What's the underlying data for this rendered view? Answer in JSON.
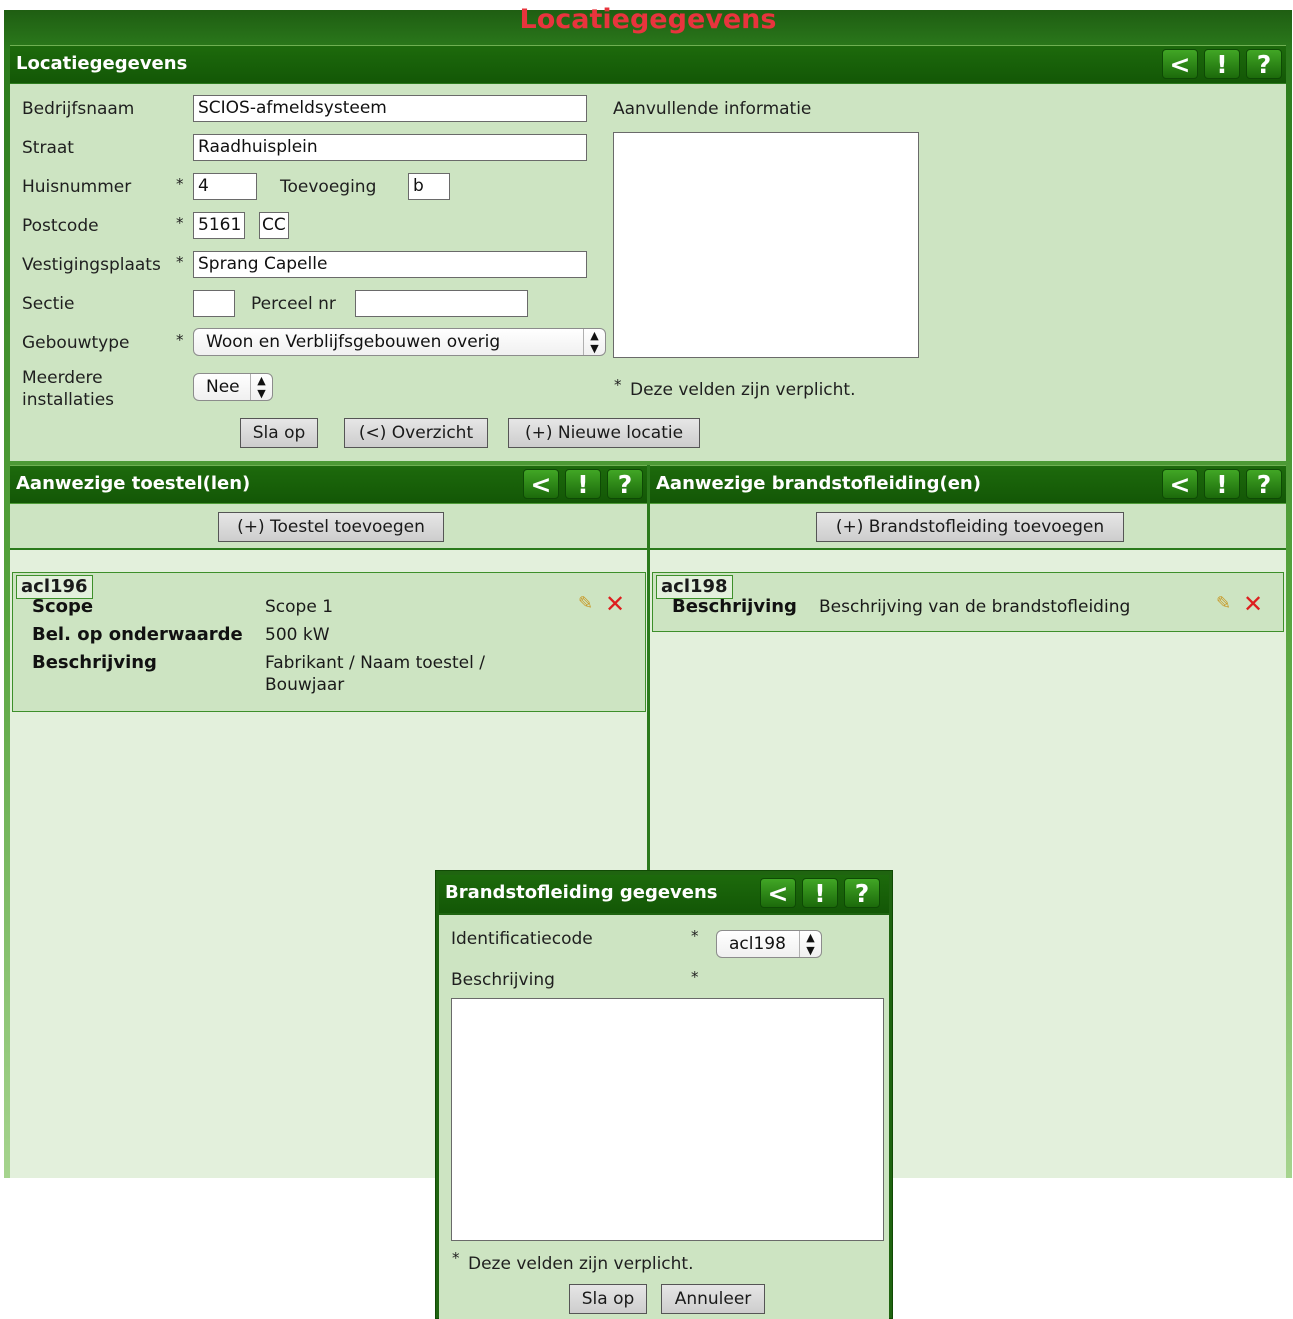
{
  "app": {
    "title": "Locatiegegevens"
  },
  "header_buttons": {
    "back": "<",
    "info": "!",
    "help": "?"
  },
  "location_panel": {
    "title": "Locatiegegevens",
    "bedrijfsnaam": {
      "label": "Bedrijfsnaam",
      "value": "SCIOS-afmeldsysteem"
    },
    "straat": {
      "label": "Straat",
      "value": "Raadhuisplein"
    },
    "huisnummer": {
      "label": "Huisnummer",
      "value": "4"
    },
    "toevoeging": {
      "label": "Toevoeging",
      "value": "b"
    },
    "postcode": {
      "label": "Postcode",
      "digits": "5161",
      "letters": "CC"
    },
    "vestigingsplaats": {
      "label": "Vestigingsplaats",
      "value": "Sprang Capelle"
    },
    "sectie": {
      "label": "Sectie",
      "value": ""
    },
    "perceel": {
      "label": "Perceel nr",
      "value": ""
    },
    "gebouwtype": {
      "label": "Gebouwtype",
      "value": "Woon en Verblijfsgebouwen overig"
    },
    "meerdere": {
      "label_line1": "Meerdere",
      "label_line2": "installaties",
      "value": "Nee"
    },
    "aanvullend": {
      "label": "Aanvullende informatie",
      "value": ""
    },
    "required_mark": "*",
    "required_note": "Deze velden zijn verplicht.",
    "buttons": {
      "save": "Sla op",
      "overview": "(<) Overzicht",
      "new_location": "(+) Nieuwe locatie"
    }
  },
  "toestellen_panel": {
    "title": "Aanwezige toestel(len)",
    "add_button": "(+) Toestel toevoegen",
    "card": {
      "id": "acl196",
      "scope_label": "Scope",
      "scope_value": "Scope 1",
      "bel_label": "Bel. op onderwaarde",
      "bel_value": "500 kW",
      "beschrijving_label": "Beschrijving",
      "beschrijving_line1": "Fabrikant / Naam toestel /",
      "beschrijving_line2": "Bouwjaar"
    }
  },
  "brandstof_panel": {
    "title": "Aanwezige brandstofleiding(en)",
    "add_button": "(+) Brandstofleiding toevoegen",
    "card": {
      "id": "acl198",
      "beschrijving_label": "Beschrijving",
      "beschrijving_value": "Beschrijving van de brandstofleiding"
    }
  },
  "modal": {
    "title": "Brandstofleiding gegevens",
    "identificatie_label": "Identificatiecode",
    "identificatie_value": "acl198",
    "beschrijving_label": "Beschrijving",
    "beschrijving_value": "",
    "required_mark": "*",
    "required_note": "Deze velden zijn verplicht.",
    "save": "Sla op",
    "cancel": "Annuleer"
  },
  "icons": {
    "edit": "pencil-icon",
    "delete": "delete-x-icon",
    "select": "select-arrows-icon"
  },
  "colors": {
    "title_red": "#e8343d",
    "header_green": "#1d6a0c",
    "panel_light": "#cde4c2",
    "delete_red": "#dd1f1f"
  }
}
